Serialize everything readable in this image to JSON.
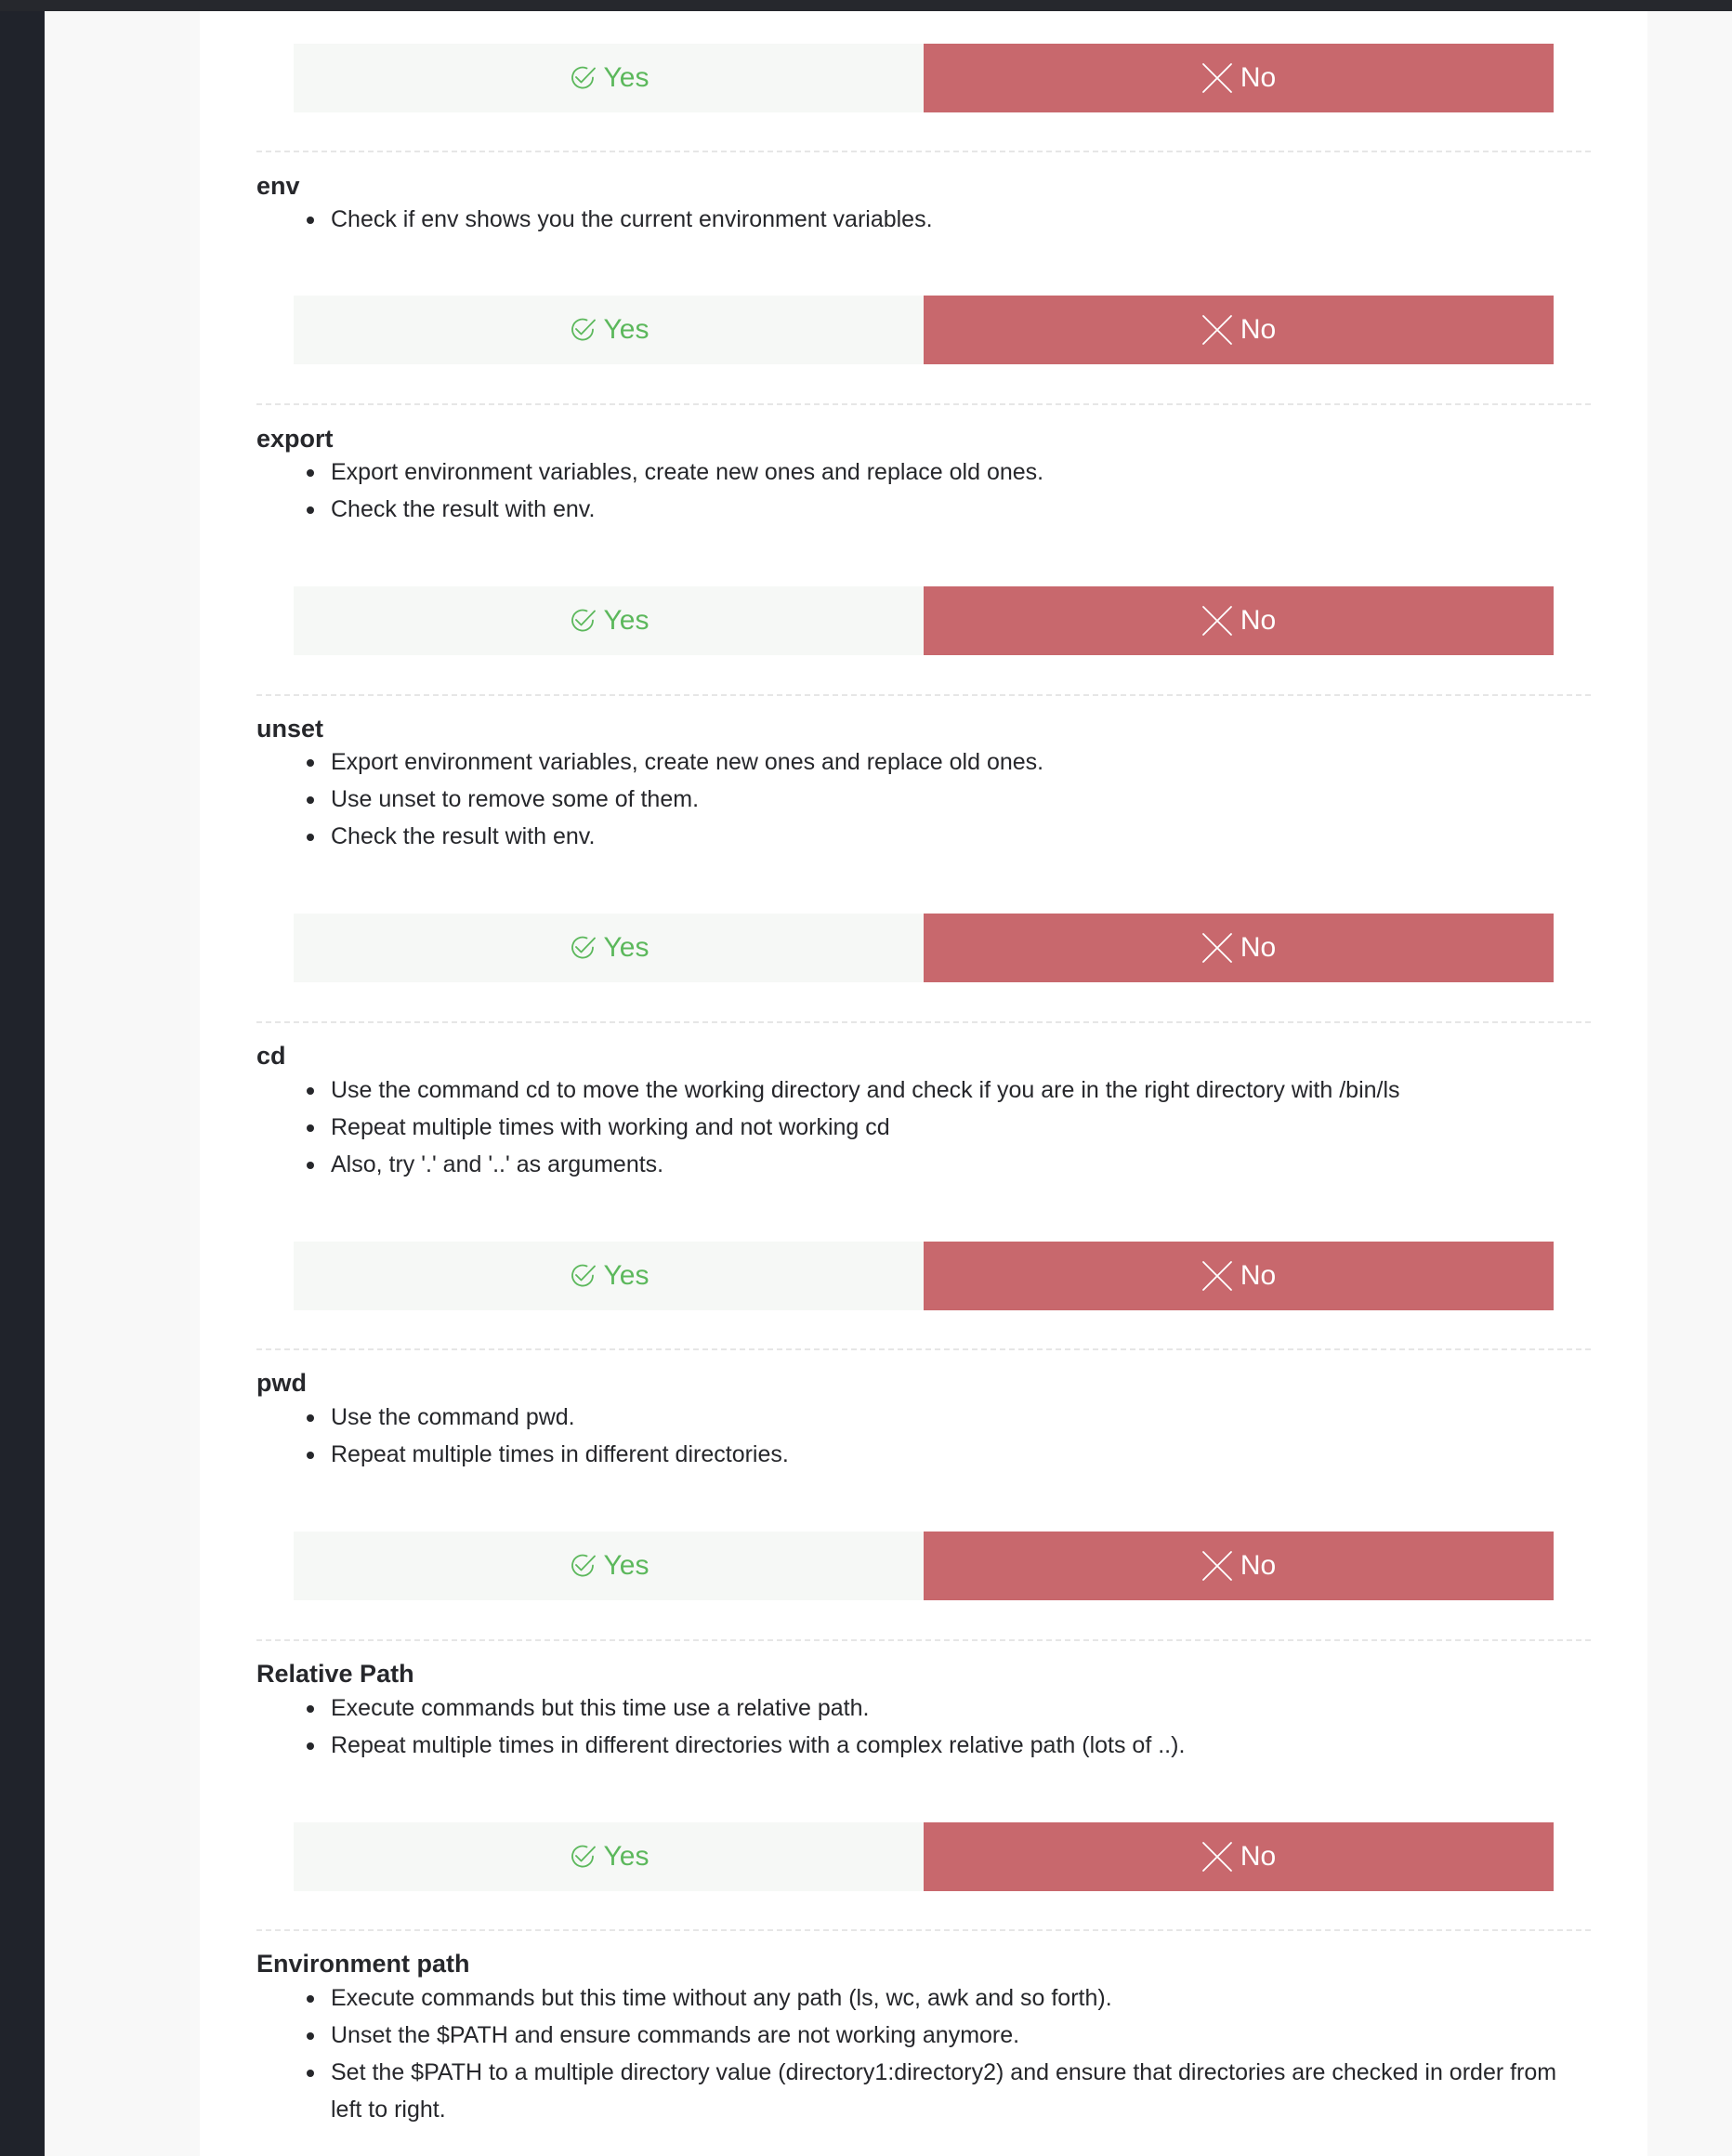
{
  "buttons": {
    "yes_label": "Yes",
    "no_label": "No"
  },
  "colors": {
    "yes_text": "#5cb85c",
    "yes_bg": "#f6f8f6",
    "no_bg": "#c8686d",
    "sidebar": "#20232b"
  },
  "sections": [
    {
      "title": "env",
      "items": [
        "Check if env shows you the current environment variables."
      ]
    },
    {
      "title": "export",
      "items": [
        "Export environment variables, create new ones and replace old ones.",
        "Check the result with env."
      ]
    },
    {
      "title": "unset",
      "items": [
        "Export environment variables, create new ones and replace old ones.",
        "Use unset to remove some of them.",
        "Check the result with env."
      ]
    },
    {
      "title": "cd",
      "items": [
        "Use the command cd to move the working directory and check if you are in the right directory with /bin/ls",
        "Repeat multiple times with working and not working cd",
        "Also, try '.' and '..' as arguments."
      ]
    },
    {
      "title": "pwd",
      "items": [
        "Use the command pwd.",
        "Repeat multiple times in different directories."
      ]
    },
    {
      "title": "Relative Path",
      "items": [
        "Execute commands but this time use a relative path.",
        "Repeat multiple times in different directories with a complex relative path (lots of ..)."
      ]
    },
    {
      "title": "Environment path",
      "items": [
        "Execute commands but this time without any path (ls, wc, awk and so forth).",
        "Unset the $PATH and ensure commands are not working anymore.",
        "Set the $PATH to a multiple directory value (directory1:directory2) and ensure that directories are checked in order from left to right."
      ]
    }
  ]
}
